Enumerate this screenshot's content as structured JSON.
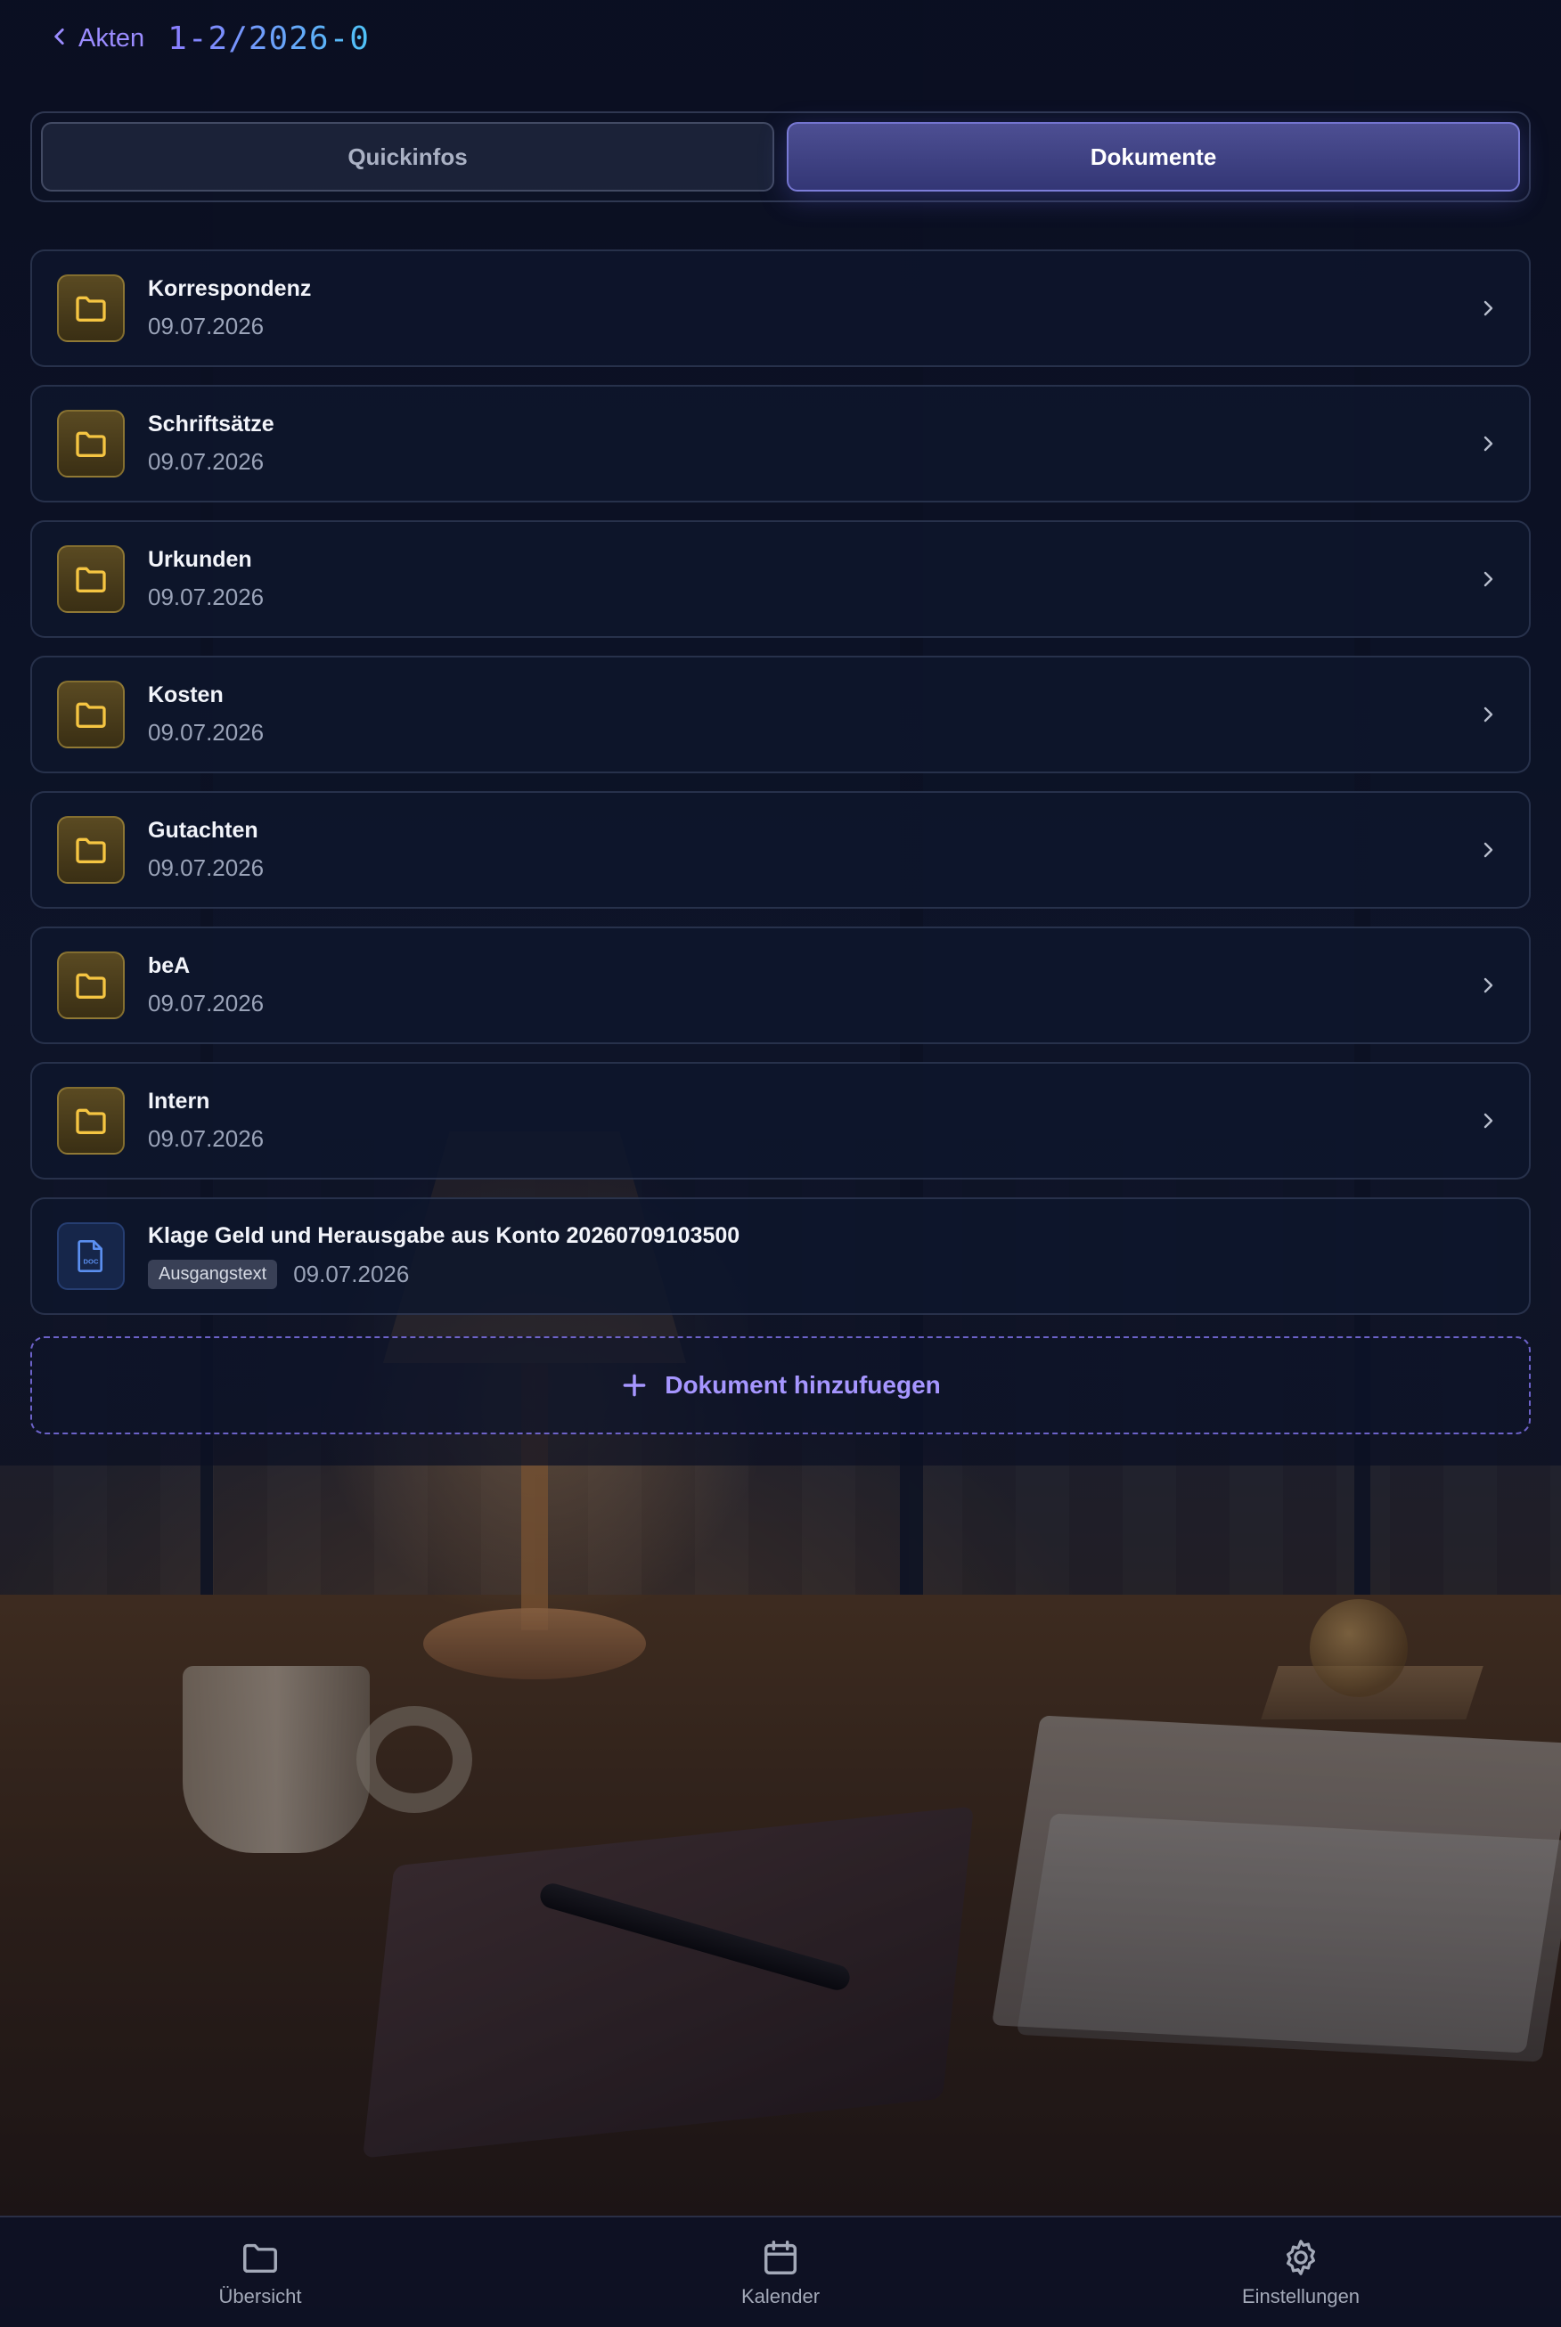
{
  "header": {
    "back_label": "Akten",
    "case_number": "1-2/2026-0"
  },
  "tabs": [
    {
      "label": "Quickinfos",
      "active": false
    },
    {
      "label": "Dokumente",
      "active": true
    }
  ],
  "folders": [
    {
      "name": "Korrespondenz",
      "date": "09.07.2026",
      "icon": "folder-icon"
    },
    {
      "name": "Schriftsätze",
      "date": "09.07.2026",
      "icon": "folder-icon"
    },
    {
      "name": "Urkunden",
      "date": "09.07.2026",
      "icon": "folder-icon"
    },
    {
      "name": "Kosten",
      "date": "09.07.2026",
      "icon": "folder-icon"
    },
    {
      "name": "Gutachten",
      "date": "09.07.2026",
      "icon": "folder-icon"
    },
    {
      "name": "beA",
      "date": "09.07.2026",
      "icon": "folder-icon"
    },
    {
      "name": "Intern",
      "date": "09.07.2026",
      "icon": "folder-icon"
    }
  ],
  "documents": [
    {
      "name": "Klage Geld und Herausgabe aus Konto 20260709103500",
      "badge": "Ausgangstext",
      "date": "09.07.2026",
      "icon": "doc-file-icon",
      "icon_text": "DOC"
    }
  ],
  "add_document": {
    "label": "Dokument hinzufuegen",
    "icon": "plus-icon"
  },
  "bottom_nav": [
    {
      "label": "Übersicht",
      "icon": "folder-icon"
    },
    {
      "label": "Kalender",
      "icon": "calendar-icon"
    },
    {
      "label": "Einstellungen",
      "icon": "gear-icon"
    }
  ],
  "colors": {
    "accent": "#9b8cff",
    "title_gradient_start": "#8b7cff",
    "title_gradient_end": "#4fc3f7",
    "folder_icon": "#f5c542",
    "active_tab": "#3d3f85",
    "text_primary": "#f2f4fa",
    "text_secondary": "#9aa3b8",
    "background": "#0b1124"
  }
}
